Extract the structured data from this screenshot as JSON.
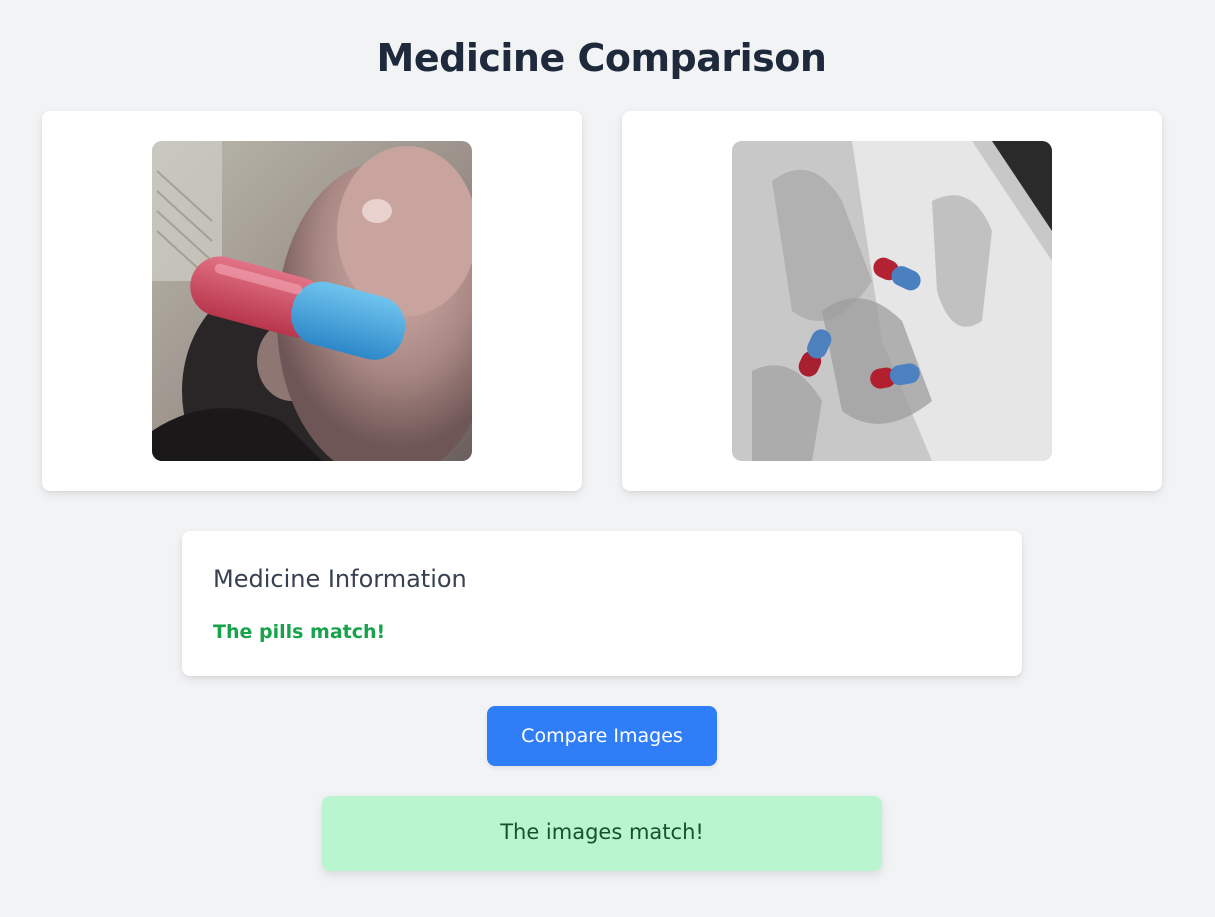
{
  "page": {
    "title": "Medicine Comparison"
  },
  "images": {
    "left": {
      "icon": "pill-closeup-photo"
    },
    "right": {
      "icon": "pills-on-paper-photo"
    }
  },
  "info": {
    "title": "Medicine Information",
    "status": "The pills match!",
    "status_color": "#16a34a"
  },
  "actions": {
    "compare_label": "Compare Images",
    "accent": "#2f7ef7"
  },
  "result": {
    "message": "The images match!",
    "background": "#b9f5cf"
  }
}
